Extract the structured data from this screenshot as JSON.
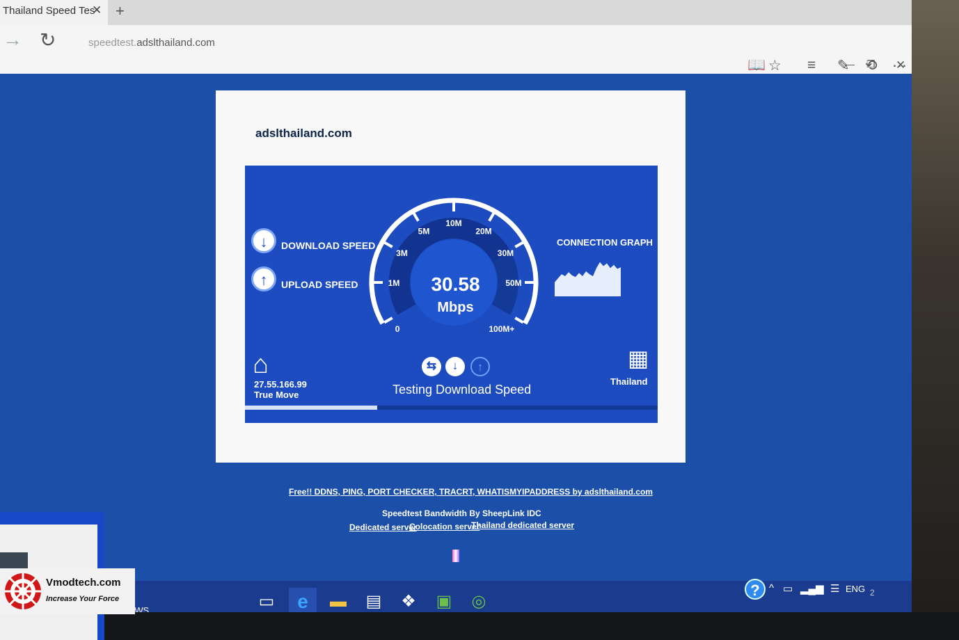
{
  "browser": {
    "tab_title": "Thailand Speed Tes",
    "tab_close": "✕",
    "new_tab": "+",
    "url_prefix": "speedtest.",
    "url_domain": "adslthailand.com",
    "icons": [
      "reading-view-icon",
      "favorite-star-icon",
      "hub-icon",
      "web-note-icon",
      "share-icon",
      "more-icon"
    ]
  },
  "page": {
    "logo": "adslthailand.com",
    "widget": {
      "download_label": "DOWNLOAD SPEED",
      "upload_label": "UPLOAD SPEED",
      "gauge_ticks": [
        "0",
        "1M",
        "3M",
        "5M",
        "10M",
        "20M",
        "30M",
        "50M",
        "100M+"
      ],
      "speed_value": "30.58",
      "speed_unit": "Mbps",
      "connection_graph_label": "CONNECTION GRAPH",
      "client_ip": "27.55.166.99",
      "client_isp": "True Move",
      "status": "Testing Download Speed",
      "server_location": "Thailand",
      "progress": 0.32,
      "graph_samples": [
        0.35,
        0.45,
        0.55,
        0.5,
        0.6,
        0.52,
        0.48,
        0.58,
        0.5,
        0.62,
        0.55,
        0.5,
        0.7,
        0.85,
        0.75,
        0.82,
        0.7,
        0.78,
        0.68,
        0.72
      ]
    },
    "footer": {
      "tools_link": "Free!! DDNS, PING, PORT CHECKER, TRACRT, WHATISMYIPADDRESS by adslthailand.com",
      "bandwidth_credit": "Speedtest Bandwidth By SheepLink IDC",
      "links": [
        "Dedicated server",
        "Colocation server",
        "Thailand dedicated server"
      ]
    }
  },
  "taskbar": {
    "windows_text": "'indows",
    "apps": [
      "task-view-icon",
      "edge-icon",
      "file-explorer-icon",
      "store-icon",
      "dropbox-icon",
      "evernote-icon",
      "tripadvisor-icon"
    ],
    "language": "ENG",
    "clock_partial": "2"
  },
  "watermark": {
    "brand": "Vmodtech.com",
    "tagline": "Increase Your Force"
  },
  "colors": {
    "screen_bg": "#1b4fa8",
    "widget_bg": "#1d4cc0",
    "accent_light": "#d6e3fb"
  }
}
